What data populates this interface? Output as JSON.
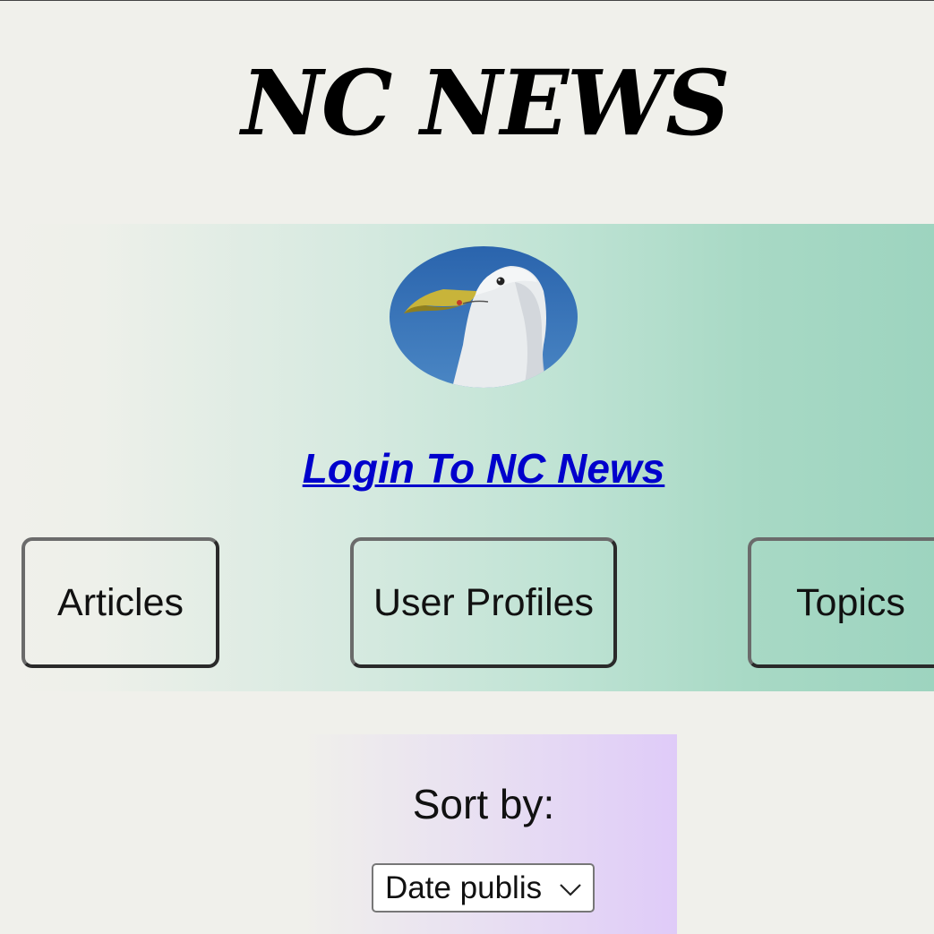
{
  "header": {
    "title": "NC NEWS"
  },
  "nav": {
    "avatar_icon": "seagull-avatar",
    "login_label": "Login To NC News",
    "buttons": [
      {
        "label": "Articles"
      },
      {
        "label": "User Profiles"
      },
      {
        "label": "Topics"
      }
    ]
  },
  "sort": {
    "label": "Sort by:",
    "selected": "Date publis"
  },
  "colors": {
    "background": "#f0f0eb",
    "nav_gradient_end": "#9dd4bf",
    "sort_gradient_end": "#dfcbf8",
    "link": "#0000cc"
  }
}
